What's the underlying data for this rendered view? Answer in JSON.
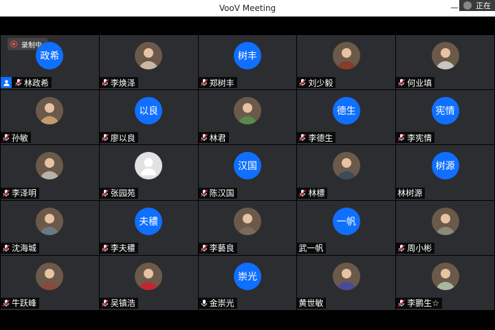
{
  "window": {
    "title": "VooV Meeting",
    "speaking_label": "正在"
  },
  "recording": {
    "label": "录制中"
  },
  "colors": {
    "avatar_blue": "#0f6fff",
    "tile_bg": "#2c2d31",
    "muted_mic": "#e0334a",
    "title_bg": "#ffffff"
  },
  "participants": [
    {
      "name": "林政希",
      "avatar_text": "政希",
      "avatar": "text",
      "mic": "muted",
      "host": true,
      "recording": true
    },
    {
      "name": "李焕泽",
      "avatar_text": "",
      "avatar": "photo",
      "photo_color": "#c9b8a5",
      "mic": "muted"
    },
    {
      "name": "郑树丰",
      "avatar_text": "树丰",
      "avatar": "text",
      "mic": "muted"
    },
    {
      "name": "刘少毅",
      "avatar_text": "",
      "avatar": "photo",
      "photo_color": "#8a3b2a",
      "mic": "muted"
    },
    {
      "name": "何业填",
      "avatar_text": "",
      "avatar": "photo",
      "photo_color": "#c8c6c0",
      "mic": "muted"
    },
    {
      "name": "孙敏",
      "avatar_text": "",
      "avatar": "photo",
      "photo_color": "#c59a6e",
      "mic": "muted"
    },
    {
      "name": "廖以良",
      "avatar_text": "以良",
      "avatar": "text",
      "mic": "muted"
    },
    {
      "name": "林君",
      "avatar_text": "",
      "avatar": "photo",
      "photo_color": "#5a8a4a",
      "mic": "muted"
    },
    {
      "name": "李德生",
      "avatar_text": "德生",
      "avatar": "text",
      "mic": "muted"
    },
    {
      "name": "李宪情",
      "avatar_text": "宪情",
      "avatar": "text",
      "mic": "muted"
    },
    {
      "name": "李泽明",
      "avatar_text": "",
      "avatar": "photo",
      "photo_color": "#b8b3a8",
      "mic": "muted"
    },
    {
      "name": "张园苑",
      "avatar_text": "",
      "avatar": "placeholder",
      "mic": "muted"
    },
    {
      "name": "陈汉国",
      "avatar_text": "汉国",
      "avatar": "text",
      "mic": "muted"
    },
    {
      "name": "林標",
      "avatar_text": "",
      "avatar": "photo",
      "photo_color": "#3c4a5a",
      "mic": "muted"
    },
    {
      "name": "林树源",
      "avatar_text": "树源",
      "avatar": "text",
      "mic": "none"
    },
    {
      "name": "沈海城",
      "avatar_text": "",
      "avatar": "photo",
      "photo_color": "#6a7a80",
      "mic": "muted"
    },
    {
      "name": "李夫穠",
      "avatar_text": "夫穠",
      "avatar": "text",
      "mic": "muted"
    },
    {
      "name": "李藝良",
      "avatar_text": "",
      "avatar": "photo",
      "photo_color": "#7a6a58",
      "mic": "muted"
    },
    {
      "name": "武一帆",
      "avatar_text": "一帆",
      "avatar": "text",
      "mic": "none"
    },
    {
      "name": "周小彬",
      "avatar_text": "",
      "avatar": "photo",
      "photo_color": "#8a8a7a",
      "mic": "muted"
    },
    {
      "name": "牛跃峰",
      "avatar_text": "",
      "avatar": "photo",
      "photo_color": "#8a4a3a",
      "mic": "muted"
    },
    {
      "name": "吴镇浩",
      "avatar_text": "",
      "avatar": "photo",
      "photo_color": "#c02830",
      "mic": "muted"
    },
    {
      "name": "金崇光",
      "avatar_text": "崇光",
      "avatar": "text",
      "mic": "on"
    },
    {
      "name": "黄世敏",
      "avatar_text": "",
      "avatar": "photo",
      "photo_color": "#4a4a9a",
      "mic": "none"
    },
    {
      "name": "李鹏生☆",
      "avatar_text": "",
      "avatar": "photo",
      "photo_color": "#a8b8a0",
      "mic": "muted"
    }
  ]
}
